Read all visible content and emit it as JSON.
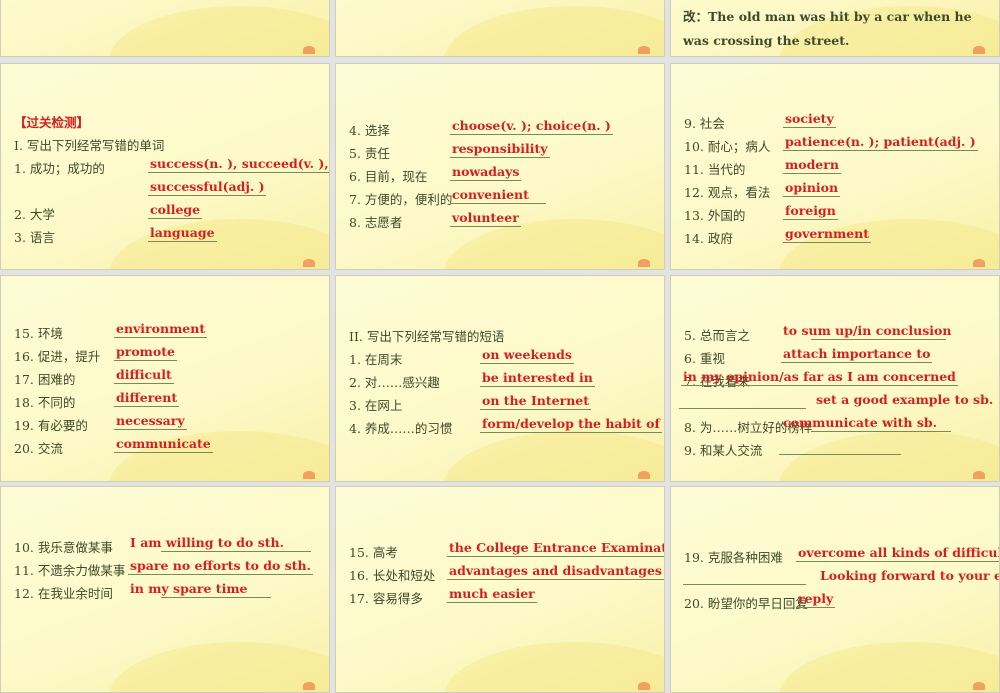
{
  "top_right": {
    "text": "改：The old man was hit by a car when he was crossing the street."
  },
  "slides": [
    {
      "items": [
        {
          "cn": "【过关检测】",
          "head": true
        },
        {
          "cn": "I. 写出下列经常写错的单词"
        },
        {
          "cn": "1. 成功；成功的",
          "ans": "success(n. ), succeed(v. ),"
        },
        {
          "cn": "",
          "ans": "successful(adj. )"
        },
        {
          "cn": "2. 大学",
          "ans": "college"
        },
        {
          "cn": "3. 语言",
          "ans": "language"
        }
      ]
    },
    {
      "items": [
        {
          "cn": "4. 选择",
          "ans": "choose(v. ); choice(n. )"
        },
        {
          "cn": "5. 责任",
          "ans": "responsibility"
        },
        {
          "cn": "6. 目前，现在",
          "ans": "nowadays"
        },
        {
          "cn": "7. 方便的，便利的",
          "ans": "convenient"
        },
        {
          "cn": "8. 志愿者",
          "ans": "volunteer"
        }
      ]
    },
    {
      "items": [
        {
          "cn": "9. 社会",
          "ans": "society"
        },
        {
          "cn": "10. 耐心；病人",
          "ans": "patience(n. ); patient(adj. )"
        },
        {
          "cn": "11. 当代的",
          "ans": "modern"
        },
        {
          "cn": "12. 观点，看法",
          "ans": "opinion"
        },
        {
          "cn": "13. 外国的",
          "ans": "foreign"
        },
        {
          "cn": "14. 政府",
          "ans": "government"
        }
      ]
    },
    {
      "items": [
        {
          "cn": "15. 环境",
          "ans": "environment"
        },
        {
          "cn": "16. 促进，提升",
          "ans": "promote"
        },
        {
          "cn": "17. 困难的",
          "ans": "difficult"
        },
        {
          "cn": "18. 不同的",
          "ans": "different"
        },
        {
          "cn": "19. 有必要的",
          "ans": "necessary"
        },
        {
          "cn": "20. 交流",
          "ans": "communicate"
        }
      ]
    },
    {
      "items": [
        {
          "cn": "II. 写出下列经常写错的短语"
        },
        {
          "cn": "1. 在周末",
          "ans": "on weekends"
        },
        {
          "cn": "2. 对……感兴趣",
          "ans": "be interested in"
        },
        {
          "cn": "3. 在网上",
          "ans": "on the Internet"
        },
        {
          "cn": "4. 养成……的习惯",
          "ans": "form/develop the habit of"
        }
      ]
    },
    {
      "items": [
        {
          "cn": "5. 总而言之",
          "ans": "to sum up/in conclusion"
        },
        {
          "cn": "6. 重视",
          "ans": "attach importance to"
        },
        {
          "cn": "7. 在我看来",
          "ans": "in my opinion/as far as I am concerned"
        },
        {
          "cn": "",
          "ans": "set a good example to sb."
        },
        {
          "cn": "8. 为……树立好的榜样",
          "ans": "communicate with sb."
        },
        {
          "cn": "9. 和某人交流",
          "ans": ""
        }
      ]
    },
    {
      "items": [
        {
          "cn": "10. 我乐意做某事",
          "ans": "I am willing to do sth."
        },
        {
          "cn": "11. 不遗余力做某事",
          "ans": "spare no efforts to do sth."
        },
        {
          "cn": "12. 在我业余时间",
          "ans": "in my spare time"
        }
      ]
    },
    {
      "items": [
        {
          "cn": "15. 高考",
          "ans": "the College Entrance Examination"
        },
        {
          "cn": "16. 长处和短处",
          "ans": "advantages and disadvantages"
        },
        {
          "cn": "17. 容易得多",
          "ans": "much easier"
        }
      ]
    },
    {
      "items": [
        {
          "cn": "19. 克服各种困难",
          "ans": "overcome all kinds of difficulties"
        },
        {
          "cn": "",
          "ans": "Looking forward to your early"
        },
        {
          "cn": "20. 盼望你的早日回复",
          "ans": "reply"
        }
      ]
    }
  ]
}
